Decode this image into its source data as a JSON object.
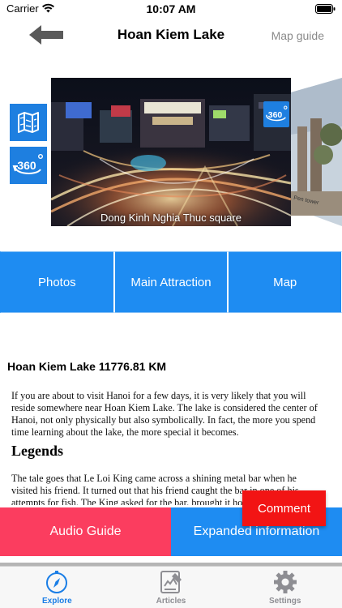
{
  "status_bar": {
    "carrier": "Carrier",
    "time": "10:07 AM"
  },
  "nav": {
    "title": "Hoan Kiem Lake",
    "right_button": "Map guide",
    "back_icon": "back-arrow-icon"
  },
  "side_buttons": [
    {
      "icon": "folded-map-icon"
    },
    {
      "icon": "360-view-icon",
      "label": "360"
    }
  ],
  "photo": {
    "caption": "Dong Kinh Nghia Thuc square",
    "badge_label": "360"
  },
  "next_photo": {
    "label": "Pen tower"
  },
  "tabs": [
    {
      "label": "Photos"
    },
    {
      "label": "Main Attraction"
    },
    {
      "label": "Map"
    }
  ],
  "article": {
    "title": "Hoan Kiem Lake 11776.81 KM",
    "paragraph1": "If you are about to visit Hanoi for a few days, it is very likely that you will reside somewhere near Hoan Kiem Lake. The lake is considered the center of Hanoi, not only physically but also symbolically. In fact, the more you spend time learning about the lake, the more special it becomes.",
    "heading": "Legends",
    "paragraph2": "The tale goes that Le Loi King came across a shining metal bar when he visited his friend. It turned out that his friend caught the bar in one of his attempts for fish. The King asked for the bar, brought it home and more"
  },
  "buttons": {
    "comment": "Comment",
    "audio_guide": "Audio Guide",
    "expanded_info": "Expanded information"
  },
  "tab_bar": [
    {
      "label": "Explore",
      "icon": "compass-icon",
      "active": true
    },
    {
      "label": "Articles",
      "icon": "articles-icon",
      "active": false
    },
    {
      "label": "Settings",
      "icon": "gear-icon",
      "active": false
    }
  ],
  "colors": {
    "blue": "#1e8cf2",
    "red": "#f21414",
    "pink": "#fb3d5f",
    "active_tab": "#1a7ee6"
  }
}
